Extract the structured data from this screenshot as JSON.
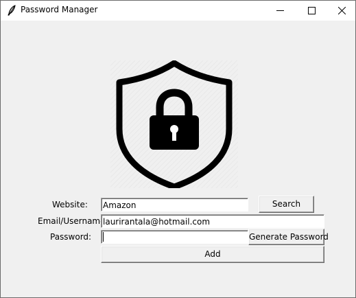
{
  "window": {
    "title": "Password Manager",
    "icon": "feather-icon",
    "controls": [
      "minimize-icon",
      "maximize-icon",
      "close-icon"
    ]
  },
  "logo": {
    "icon": "shield-lock-icon",
    "color": "#000000"
  },
  "form": {
    "website_label": "Website:",
    "website_value": "Amazon",
    "email_label": "Email/Username:",
    "email_value": "laurirantala@hotmail.com",
    "password_label": "Password:",
    "password_value": ""
  },
  "buttons": {
    "search": "Search",
    "generate": "Generate Password",
    "add": "Add"
  }
}
